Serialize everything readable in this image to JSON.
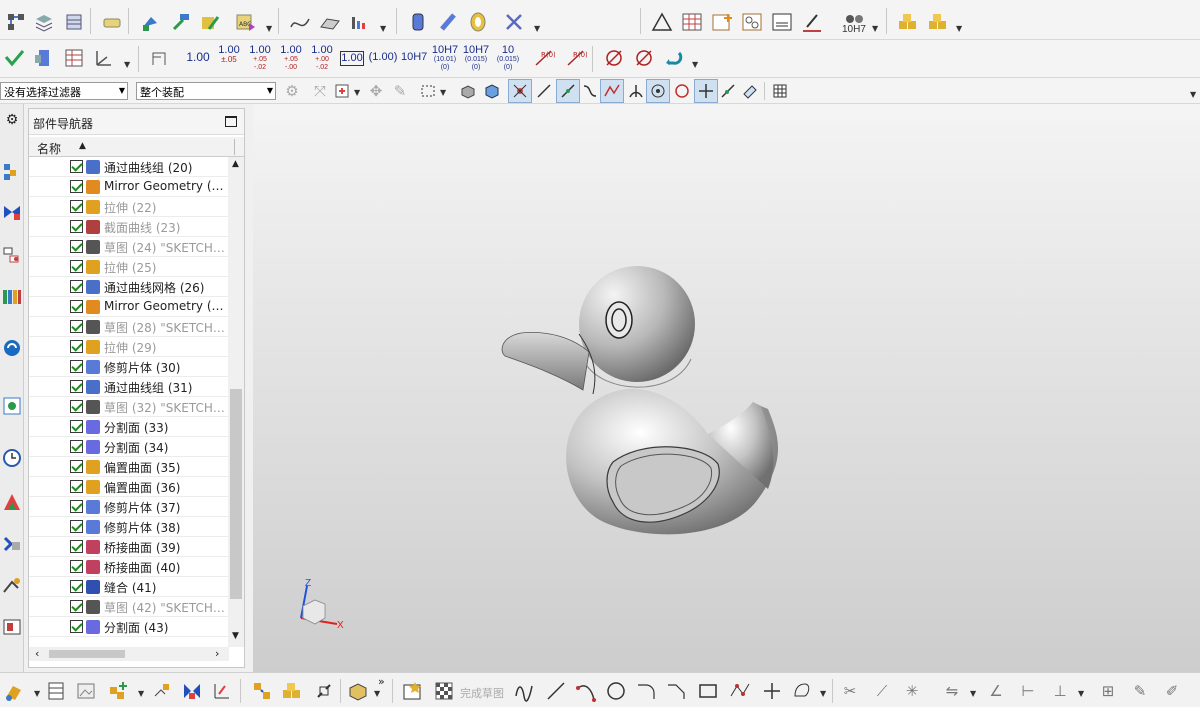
{
  "colors": {
    "viewport_top": "#f5f5f5",
    "viewport_bottom": "#cfcfcf",
    "check": "#1a8a1a",
    "tol_text": "#1a2d8a"
  },
  "toolbar_top": {
    "icons": [
      "datum-csys-icon",
      "layer-settings-icon",
      "layer-copy-icon",
      "surface-finish-icon",
      "assembly-icon",
      "hammer-icon",
      "pmi-icon",
      "abc-text-icon",
      "curve-tool-icon",
      "surface-tool-icon",
      "chart-tool-icon",
      "cylinder-measure-icon",
      "spring-icon",
      "ring-icon",
      "wrench-icon",
      "triangle-icon",
      "table-icon",
      "add-grid-icon",
      "balloon-icon",
      "note-icon",
      "brush-icon",
      "tolerance-icon",
      "box-add-icon",
      "box-edit-icon"
    ],
    "tol_label": "10H7"
  },
  "toolbar_pmi": {
    "dims": [
      {
        "main": "1.00",
        "sub": ""
      },
      {
        "main": "1.00",
        "sub": "±.05"
      },
      {
        "main": "1.00",
        "sub": "+.05\n-.02"
      },
      {
        "main": "1.00",
        "sub": "+.05\n-.00"
      },
      {
        "main": "1.00",
        "sub": "+.00\n-.02"
      }
    ],
    "boxed": "1.00",
    "paren": "(1.00)",
    "fit1": "10H7",
    "fit2": {
      "main": "10H7",
      "sub": "(10.01)\n(0)"
    },
    "fit3": {
      "main": "10H7",
      "sub": "(0.015)\n(0)"
    },
    "fit4": {
      "main": "10",
      "sub": "(0.015)\n(0)"
    },
    "r_label": "R(0)"
  },
  "selection_bar": {
    "filter_value": "没有选择过滤器",
    "scope_value": "整个装配"
  },
  "navigator": {
    "title": "部件导航器",
    "col_name": "名称",
    "rows": [
      {
        "label": "通过曲线组 (20)",
        "dim": false,
        "icon": "#4a6fc8"
      },
      {
        "label": "Mirror Geometry (2...",
        "dim": false,
        "icon": "#e08a20"
      },
      {
        "label": "拉伸 (22)",
        "dim": true,
        "icon": "#e0a020"
      },
      {
        "label": "截面曲线 (23)",
        "dim": true,
        "icon": "#b04040"
      },
      {
        "label": "草图 (24) \"SKETCH_...",
        "dim": true,
        "icon": "#555555"
      },
      {
        "label": "拉伸 (25)",
        "dim": true,
        "icon": "#e0a020"
      },
      {
        "label": "通过曲线网格 (26)",
        "dim": false,
        "icon": "#4a6fc8"
      },
      {
        "label": "Mirror Geometry (2...",
        "dim": false,
        "icon": "#e08a20"
      },
      {
        "label": "草图 (28) \"SKETCH_...",
        "dim": true,
        "icon": "#555555"
      },
      {
        "label": "拉伸 (29)",
        "dim": true,
        "icon": "#e0a020"
      },
      {
        "label": "修剪片体 (30)",
        "dim": false,
        "icon": "#5a7ad8"
      },
      {
        "label": "通过曲线组 (31)",
        "dim": false,
        "icon": "#4a6fc8"
      },
      {
        "label": "草图 (32) \"SKETCH_...",
        "dim": true,
        "icon": "#555555"
      },
      {
        "label": "分割面 (33)",
        "dim": false,
        "icon": "#6a6ae0"
      },
      {
        "label": "分割面 (34)",
        "dim": false,
        "icon": "#6a6ae0"
      },
      {
        "label": "偏置曲面 (35)",
        "dim": false,
        "icon": "#e0a020"
      },
      {
        "label": "偏置曲面 (36)",
        "dim": false,
        "icon": "#e0a020"
      },
      {
        "label": "修剪片体 (37)",
        "dim": false,
        "icon": "#5a7ad8"
      },
      {
        "label": "修剪片体 (38)",
        "dim": false,
        "icon": "#5a7ad8"
      },
      {
        "label": "桥接曲面 (39)",
        "dim": false,
        "icon": "#c04060"
      },
      {
        "label": "桥接曲面 (40)",
        "dim": false,
        "icon": "#c04060"
      },
      {
        "label": "缝合 (41)",
        "dim": false,
        "icon": "#3050b0"
      },
      {
        "label": "草图 (42) \"SKETCH_...",
        "dim": true,
        "icon": "#555555"
      },
      {
        "label": "分割面 (43)",
        "dim": false,
        "icon": "#6a6ae0"
      }
    ]
  },
  "viewport": {
    "axis_z": "Z",
    "axis_x": "X"
  },
  "bottom_toolbar": {
    "finish_sketch": "完成草图"
  }
}
